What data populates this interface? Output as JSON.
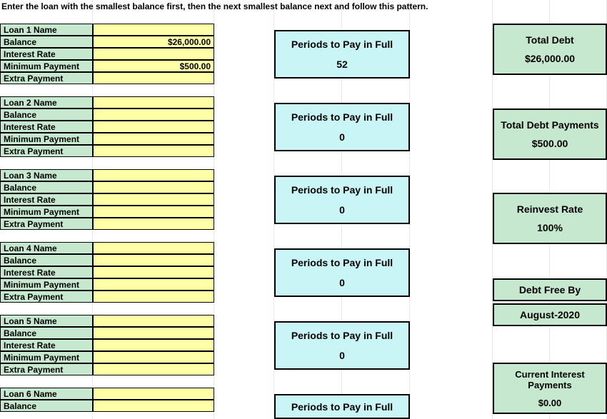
{
  "instruction": "Enter the loan with the smallest balance first, then the next smallest balance next and follow this pattern.",
  "loan_labels": {
    "name_prefix": "Loan ",
    "name_suffix": " Name",
    "balance": "Balance",
    "interest_rate": "Interest Rate",
    "minimum_payment": "Minimum Payment",
    "extra_payment": "Extra Payment"
  },
  "loans": [
    {
      "num": "1",
      "name": "",
      "balance": "$26,000.00",
      "interest_rate": "",
      "minimum_payment": "$500.00",
      "extra_payment": ""
    },
    {
      "num": "2",
      "name": "",
      "balance": "",
      "interest_rate": "",
      "minimum_payment": "",
      "extra_payment": ""
    },
    {
      "num": "3",
      "name": "",
      "balance": "",
      "interest_rate": "",
      "minimum_payment": "",
      "extra_payment": ""
    },
    {
      "num": "4",
      "name": "",
      "balance": "",
      "interest_rate": "",
      "minimum_payment": "",
      "extra_payment": ""
    },
    {
      "num": "5",
      "name": "",
      "balance": "",
      "interest_rate": "",
      "minimum_payment": "",
      "extra_payment": ""
    },
    {
      "num": "6",
      "name": "",
      "balance": "",
      "interest_rate": "",
      "minimum_payment": "",
      "extra_payment": ""
    }
  ],
  "periods": {
    "label": "Periods to Pay in Full",
    "values": [
      "52",
      "0",
      "0",
      "0",
      "0",
      ""
    ]
  },
  "summary": {
    "total_debt_label": "Total Debt",
    "total_debt_value": "$26,000.00",
    "total_payments_label": "Total Debt Payments",
    "total_payments_value": "$500.00",
    "reinvest_label": "Reinvest Rate",
    "reinvest_value": "100%",
    "debt_free_label": "Debt Free By",
    "debt_free_value": "August-2020",
    "interest_label": "Current Interest Payments",
    "interest_value": "$0.00"
  }
}
